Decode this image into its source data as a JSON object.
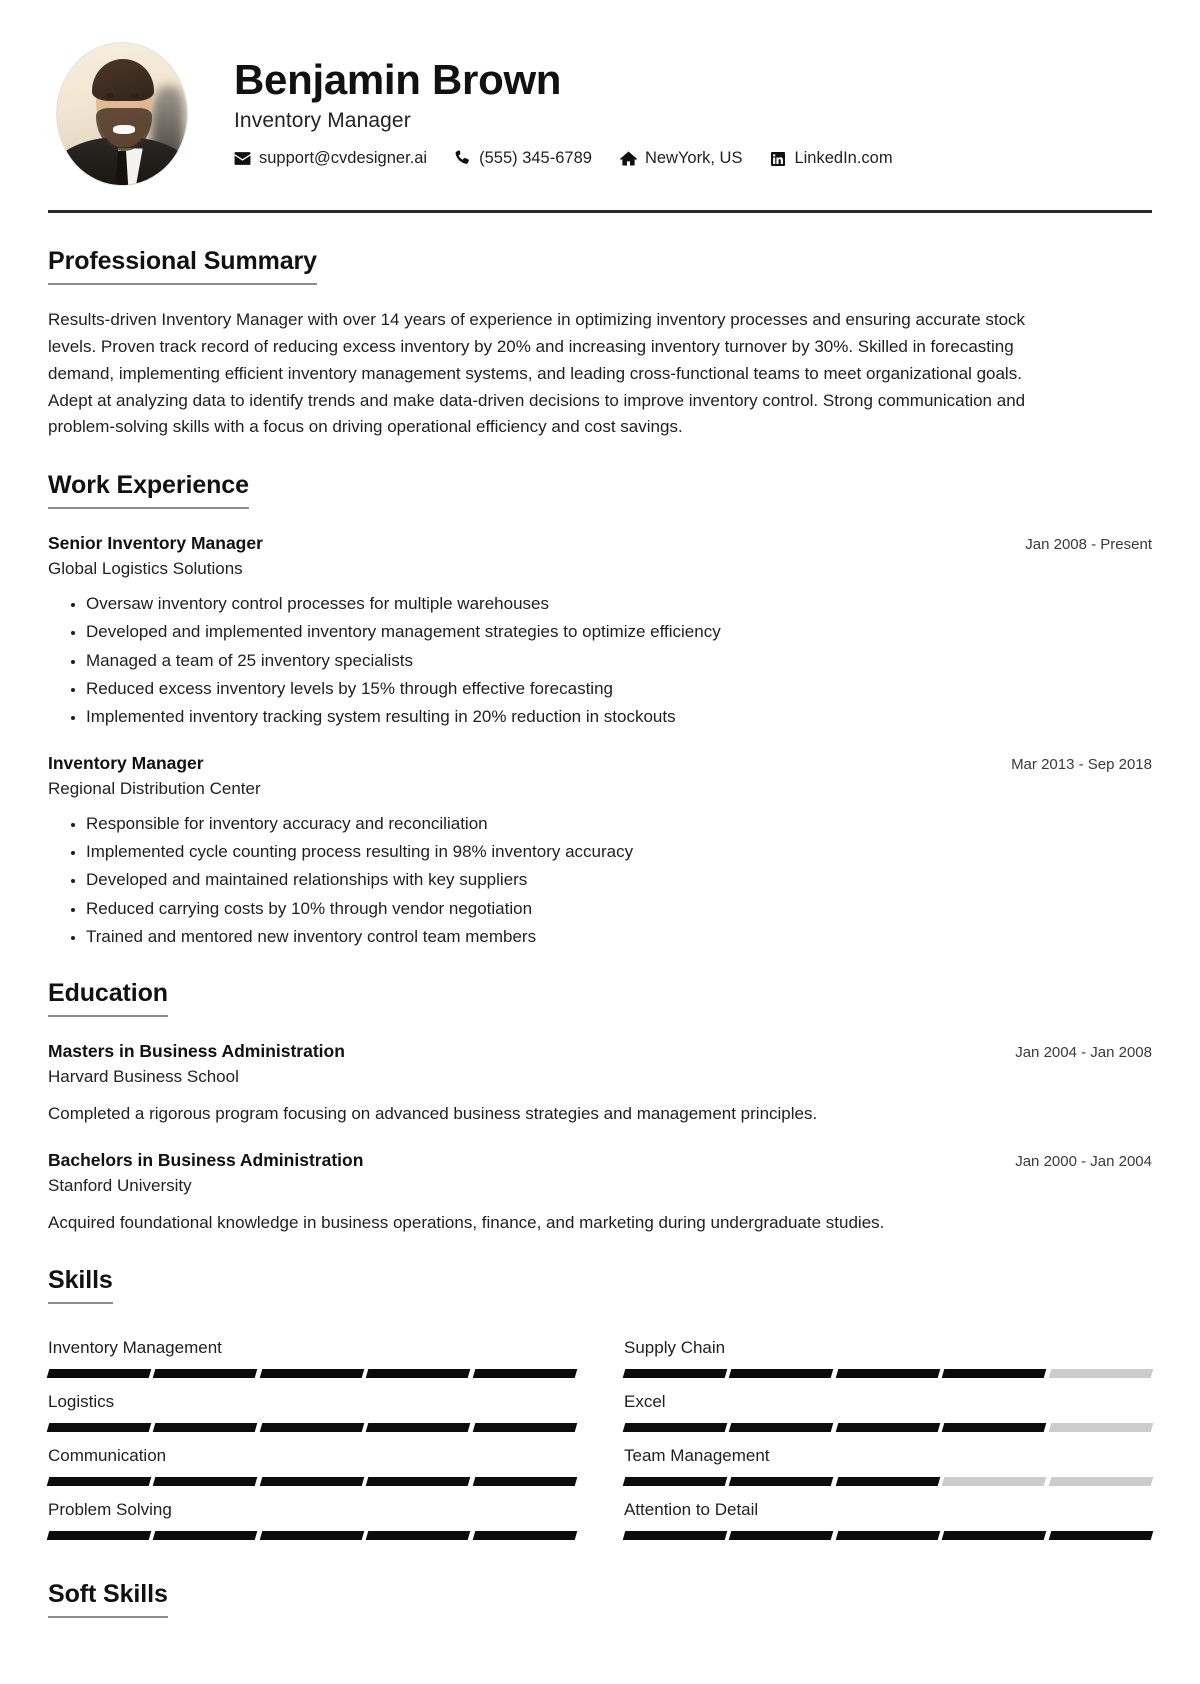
{
  "header": {
    "name": "Benjamin Brown",
    "job_title": "Inventory Manager",
    "avatar_alt": "profile-photo",
    "contacts": [
      {
        "icon": "envelope-icon",
        "label": "support@cvdesigner.ai"
      },
      {
        "icon": "phone-icon",
        "label": "(555) 345-6789"
      },
      {
        "icon": "home-icon",
        "label": "NewYork, US"
      },
      {
        "icon": "linkedin-icon",
        "label": "LinkedIn.com"
      }
    ]
  },
  "summary": {
    "title": "Professional Summary",
    "text": "Results-driven Inventory Manager with over 14 years of experience in optimizing inventory processes and ensuring accurate stock levels. Proven track record of reducing excess inventory by 20% and increasing inventory turnover by 30%. Skilled in forecasting demand, implementing efficient inventory management systems, and leading cross-functional teams to meet organizational goals. Adept at analyzing data to identify trends and make data-driven decisions to improve inventory control. Strong communication and problem-solving skills with a focus on driving operational efficiency and cost savings."
  },
  "work_experience": {
    "title": "Work Experience",
    "entries": [
      {
        "role": "Senior Inventory Manager",
        "organization": "Global Logistics Solutions",
        "date": "Jan 2008 - Present",
        "bullets": [
          "Oversaw inventory control processes for multiple warehouses",
          "Developed and implemented inventory management strategies to optimize efficiency",
          "Managed a team of 25 inventory specialists",
          "Reduced excess inventory levels by 15% through effective forecasting",
          "Implemented inventory tracking system resulting in 20% reduction in stockouts"
        ]
      },
      {
        "role": "Inventory Manager",
        "organization": "Regional Distribution Center",
        "date": "Mar 2013 - Sep 2018",
        "bullets": [
          "Responsible for inventory accuracy and reconciliation",
          "Implemented cycle counting process resulting in 98% inventory accuracy",
          "Developed and maintained relationships with key suppliers",
          "Reduced carrying costs by 10% through vendor negotiation",
          "Trained and mentored new inventory control team members"
        ]
      }
    ]
  },
  "education": {
    "title": "Education",
    "entries": [
      {
        "degree": "Masters in Business Administration",
        "school": "Harvard Business School",
        "date": "Jan 2004 - Jan 2008",
        "description": "Completed a rigorous program focusing on advanced business strategies and management principles."
      },
      {
        "degree": "Bachelors in Business Administration",
        "school": "Stanford University",
        "date": "Jan 2000 - Jan 2004",
        "description": "Acquired foundational knowledge in business operations, finance, and marketing during undergraduate studies."
      }
    ]
  },
  "skills": {
    "title": "Skills",
    "segments_total": 5,
    "items": [
      {
        "name": "Inventory Management",
        "filled": 5,
        "column": "left"
      },
      {
        "name": "Supply Chain",
        "filled": 4,
        "column": "right"
      },
      {
        "name": "Logistics",
        "filled": 5,
        "column": "left"
      },
      {
        "name": "Excel",
        "filled": 4,
        "column": "right"
      },
      {
        "name": "Communication",
        "filled": 5,
        "column": "left"
      },
      {
        "name": "Team Management",
        "filled": 3,
        "column": "right"
      },
      {
        "name": "Problem Solving",
        "filled": 5,
        "column": "left"
      },
      {
        "name": "Attention to Detail",
        "filled": 5,
        "column": "right"
      }
    ]
  },
  "soft_skills": {
    "title": "Soft Skills"
  },
  "colors": {
    "text": "#1f1f1f",
    "heading": "#111111",
    "rule": "#2b2b2b",
    "section_underline": "#8d8d8d",
    "bar_filled": "#0c0c0c",
    "bar_empty": "#cccccc"
  }
}
